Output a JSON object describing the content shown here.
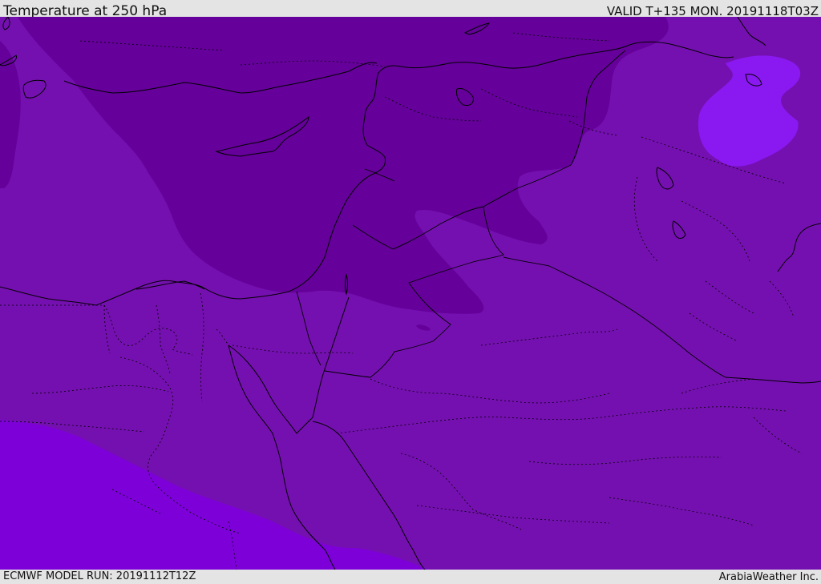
{
  "header": {
    "title": "Temperature at 250 hPa",
    "valid": "VALID T+135 MON. 20191118T03Z"
  },
  "footer": {
    "model_run": "ECMWF MODEL RUN: 20191112T12Z",
    "credit": "ArabiaWeather Inc."
  },
  "map": {
    "variable": "temperature",
    "pressure_level": "250 hPa",
    "colors": {
      "base_field": "#7510b0",
      "cold_core": "#65009a",
      "warm_south": "#7d00d8",
      "warm_northeast": "#8a18f0",
      "borders": "#000000"
    },
    "icons": [
      "coastline-line",
      "country-border-line",
      "province-border-line"
    ]
  }
}
